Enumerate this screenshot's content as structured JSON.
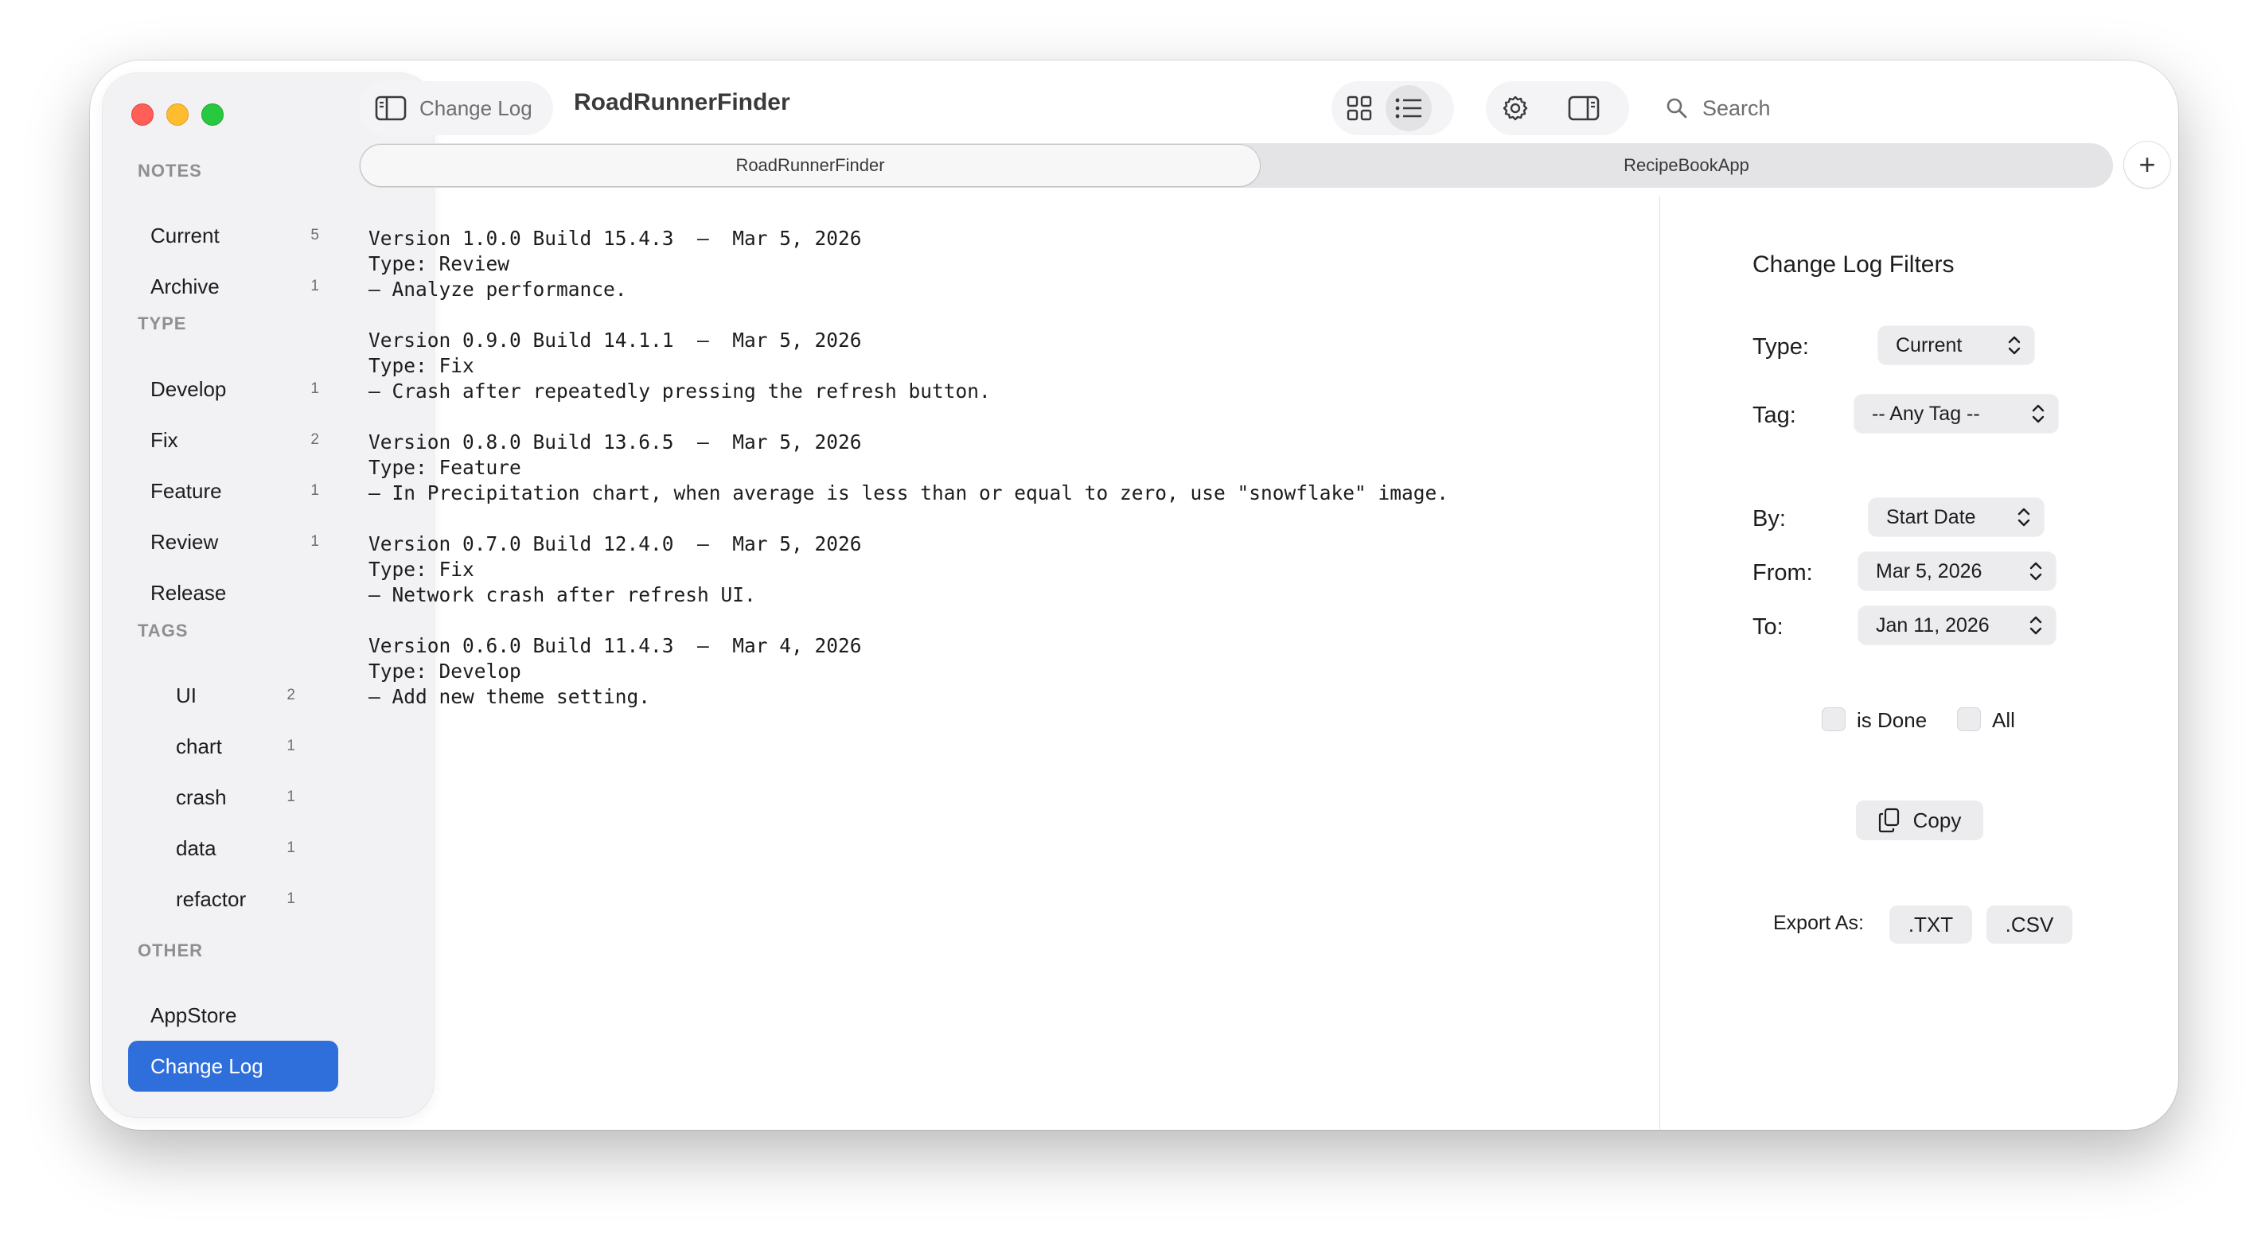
{
  "sidebar": {
    "notes_heading": "NOTES",
    "notes": [
      {
        "label": "Current",
        "count": "5"
      },
      {
        "label": "Archive",
        "count": "1"
      }
    ],
    "type_heading": "TYPE",
    "types": [
      {
        "label": "Develop",
        "count": "1"
      },
      {
        "label": "Fix",
        "count": "2"
      },
      {
        "label": "Feature",
        "count": "1"
      },
      {
        "label": "Review",
        "count": "1"
      },
      {
        "label": "Release",
        "count": ""
      }
    ],
    "tags_heading": "TAGS",
    "tags": [
      {
        "label": "UI",
        "count": "2"
      },
      {
        "label": "chart",
        "count": "1"
      },
      {
        "label": "crash",
        "count": "1"
      },
      {
        "label": "data",
        "count": "1"
      },
      {
        "label": "refactor",
        "count": "1"
      }
    ],
    "other_heading": "OTHER",
    "other": [
      {
        "label": "AppStore"
      },
      {
        "label": "Change Log",
        "selected": true
      }
    ]
  },
  "toolbar": {
    "sidebar_toggle_label": "Change Log",
    "title": "RoadRunnerFinder",
    "search_placeholder": "Search",
    "icons": [
      "sidebar-toggle-icon",
      "grid-view-icon",
      "list-view-icon",
      "gear-icon",
      "inspector-toggle-icon",
      "search-icon"
    ]
  },
  "tabs": [
    {
      "label": "RoadRunnerFinder",
      "active": true
    },
    {
      "label": "RecipeBookApp",
      "active": false
    }
  ],
  "tab_add_label": "+",
  "changelog": [
    {
      "header": "Version 1.0.0 Build 15.4.3  –  Mar 5, 2026",
      "type": "Type: Review",
      "note": "– Analyze performance."
    },
    {
      "header": "Version 0.9.0 Build 14.1.1  –  Mar 5, 2026",
      "type": "Type: Fix",
      "note": "– Crash after repeatedly pressing the refresh button."
    },
    {
      "header": "Version 0.8.0 Build 13.6.5  –  Mar 5, 2026",
      "type": "Type: Feature",
      "note": "– In Precipitation chart, when average is less than or equal to zero, use \"snowflake\" image."
    },
    {
      "header": "Version 0.7.0 Build 12.4.0  –  Mar 5, 2026",
      "type": "Type: Fix",
      "note": "– Network crash after refresh UI."
    },
    {
      "header": "Version 0.6.0 Build 11.4.3  –  Mar 4, 2026",
      "type": "Type: Develop",
      "note": "– Add new theme setting."
    }
  ],
  "filters": {
    "title": "Change Log Filters",
    "type_label": "Type:",
    "type_value": "Current",
    "tag_label": "Tag:",
    "tag_value": "-- Any Tag --",
    "by_label": "By:",
    "by_value": "Start Date",
    "from_label": "From:",
    "from_value": "Mar 5, 2026",
    "to_label": "To:",
    "to_value": "Jan 11, 2026",
    "is_done_label": "is Done",
    "all_label": "All",
    "copy_label": "Copy",
    "export_label": "Export As:",
    "export_txt": ".TXT",
    "export_csv": ".CSV"
  },
  "colors": {
    "accent": "#2f6fdc",
    "traffic_red": "#ff5f57",
    "traffic_yellow": "#febc2e",
    "traffic_green": "#28c840"
  }
}
